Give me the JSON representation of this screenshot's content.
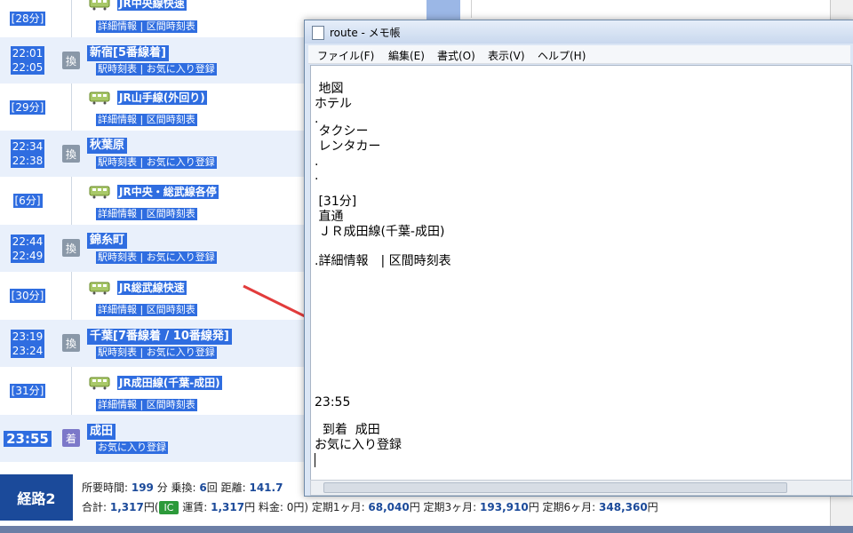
{
  "left_panel": {
    "rows": [
      {
        "type": "segment",
        "duration": "[28分]",
        "line": "JR中央線快速",
        "links": "詳細情報 | 区間時刻表"
      },
      {
        "type": "station",
        "times": [
          "22:01",
          "22:05"
        ],
        "badge": "換",
        "name": "新宿[5番線着]",
        "links": "駅時刻表 | お気に入り登録"
      },
      {
        "type": "segment",
        "duration": "[29分]",
        "line": "JR山手線(外回り)",
        "links": "詳細情報 | 区間時刻表"
      },
      {
        "type": "station",
        "times": [
          "22:34",
          "22:38"
        ],
        "badge": "換",
        "name": "秋葉原",
        "links": "駅時刻表 | お気に入り登録"
      },
      {
        "type": "segment",
        "duration": "[6分]",
        "line": "JR中央・総武線各停",
        "links": "詳細情報 | 区間時刻表"
      },
      {
        "type": "station",
        "times": [
          "22:44",
          "22:49"
        ],
        "badge": "換",
        "name": "錦糸町",
        "links": "駅時刻表 | お気に入り登録"
      },
      {
        "type": "segment",
        "duration": "[30分]",
        "line": "JR総武線快速",
        "links": "詳細情報 | 区間時刻表"
      },
      {
        "type": "station",
        "times": [
          "23:19",
          "23:24"
        ],
        "badge": "換",
        "name": "千葉[7番線着 / 10番線発]",
        "links": "駅時刻表 | お気に入り登録"
      },
      {
        "type": "segment",
        "duration": "[31分]",
        "line": "JR成田線(千葉-成田)",
        "links": "詳細情報 | 区間時刻表"
      },
      {
        "type": "arrival",
        "time": "23:55",
        "badge": "着",
        "name": "成田",
        "links": "お気に入り登録"
      }
    ]
  },
  "summary": {
    "route_label": "経路2",
    "line1": {
      "time_label": "所要時間: ",
      "time_value": "199",
      "time_unit": " 分 乗換: ",
      "transfer_value": "6",
      "transfer_unit": "回 距離: ",
      "distance_value": "141.7"
    },
    "line2": {
      "total_label": "合計: ",
      "total_value": "1,317",
      "total_unit": "円(",
      "ic": "IC",
      "fare_label": " 運賃: ",
      "fare_value": "1,317",
      "fare_unit": "円 料金: ",
      "fee_text": "0円) 定期1ヶ月: ",
      "pass1": "68,040",
      "p1unit": "円 定期3ヶ月: ",
      "pass3": "193,910",
      "p3unit": "円 定期6ヶ月: ",
      "pass6": "348,360",
      "p6unit": "円"
    }
  },
  "notepad": {
    "title": "route - メモ帳",
    "menu": [
      "ファイル(F)",
      "編集(E)",
      "書式(O)",
      "表示(V)",
      "ヘルプ(H)"
    ],
    "lines": [
      " 地図",
      "ホテル",
      ".",
      " タクシー",
      " レンタカー",
      ".",
      ".",
      " [31分]",
      " 直通",
      " ＪＲ成田線(千葉-成田)",
      ".詳細情報　| 区間時刻表",
      "23:55",
      "  到着  成田",
      "お気に入り登録"
    ]
  },
  "colors": {
    "selection": "#2f6de0",
    "route_label": "#1b4a9a",
    "ic": "#2c9a3a",
    "arrow": "#e23c3c"
  }
}
